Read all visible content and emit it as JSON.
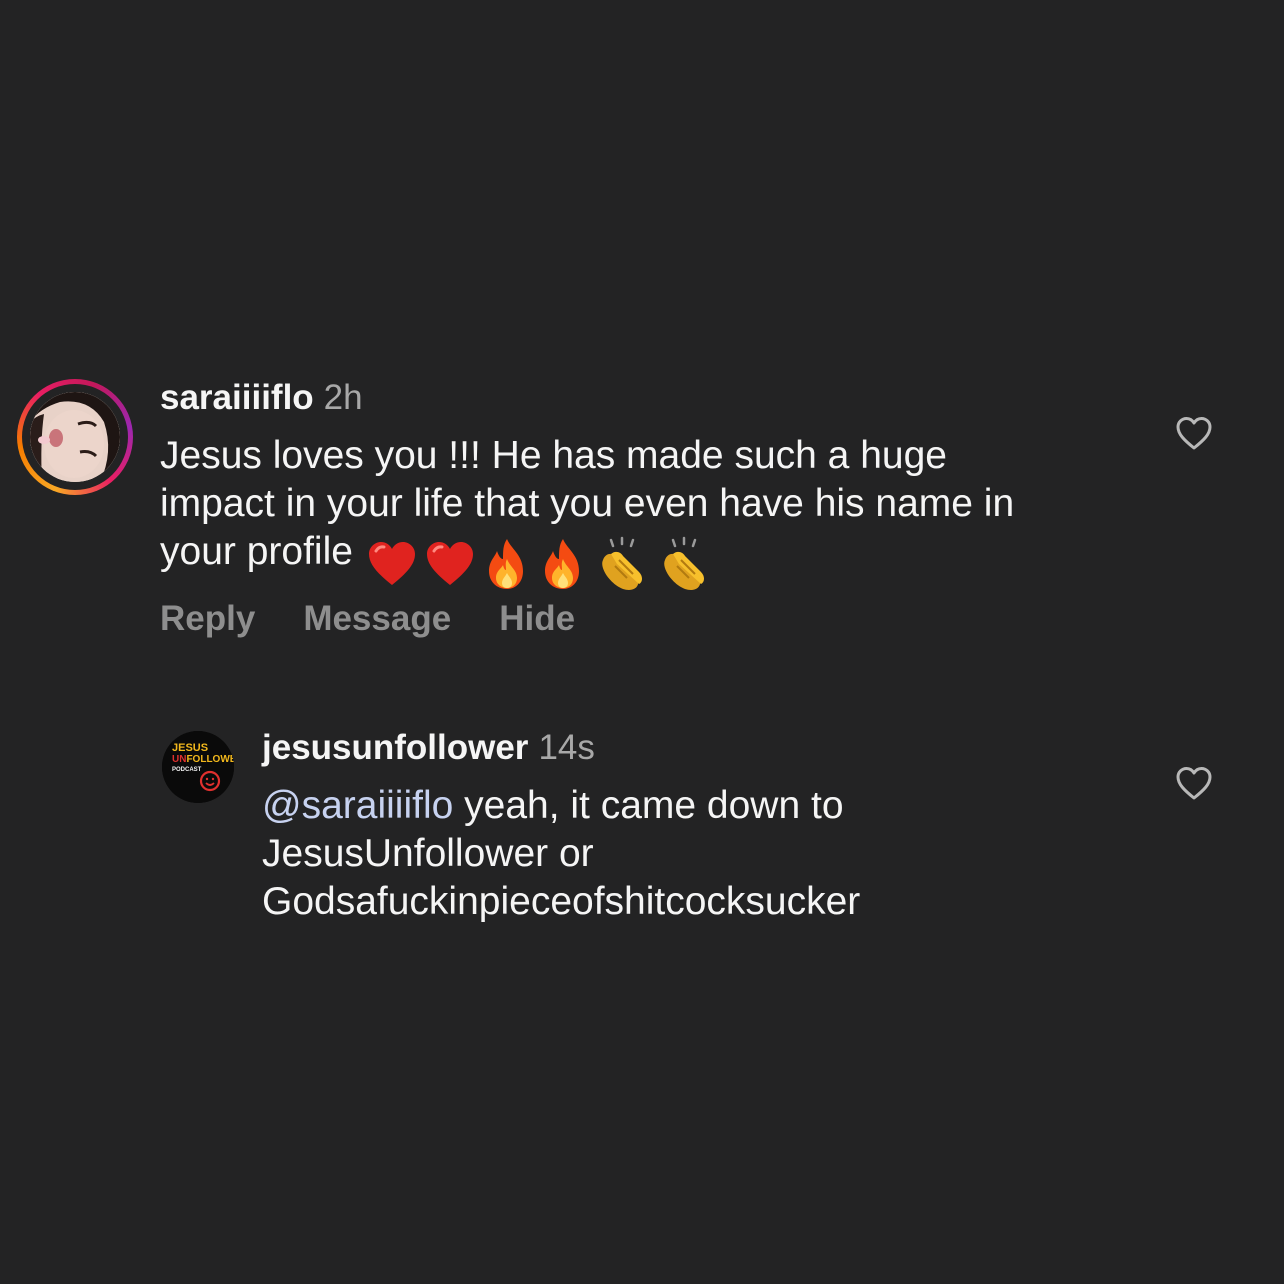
{
  "comments": [
    {
      "username": "saraiiiiflo",
      "time": "2h",
      "text_lines": [
        "Jesus loves you !!! He has made such a huge",
        "impact in your life that you even have his name in",
        "your profile"
      ],
      "emojis": [
        "red-heart",
        "red-heart",
        "fire",
        "fire",
        "clapping-hands",
        "clapping-hands"
      ],
      "actions": {
        "reply": "Reply",
        "message": "Message",
        "hide": "Hide"
      }
    },
    {
      "username": "jesusunfollower",
      "time": "14s",
      "mention": "@saraiiiiflo",
      "text_first": " yeah, it came down to",
      "text_lines": [
        "JesusUnfollower or",
        "Godsafuckinpieceofshitcocksucker"
      ]
    }
  ],
  "logo": {
    "line1": "JESUS",
    "line2_prefix": "UN",
    "line2": "FOLLOWER",
    "line3": "PODCAST"
  },
  "colors": {
    "background": "#232324",
    "text": "#f5f5f5",
    "secondary": "#a8a8a8",
    "mention": "#c7d2f0",
    "logo_accent": "#e0302e"
  }
}
